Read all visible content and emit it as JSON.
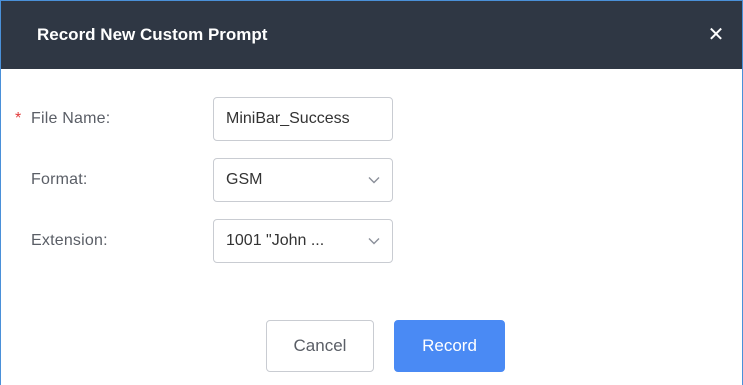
{
  "dialog": {
    "title": "Record New Custom Prompt",
    "close_glyph": "✕"
  },
  "form": {
    "file_name": {
      "required_mark": "*",
      "label": "File Name:",
      "value": "MiniBar_Success"
    },
    "format": {
      "label": "Format:",
      "selected": "GSM"
    },
    "extension": {
      "label": "Extension:",
      "selected": "1001 \"John ..."
    }
  },
  "buttons": {
    "cancel_label": "Cancel",
    "record_label": "Record"
  },
  "colors": {
    "header_bg": "#2f3744",
    "primary": "#4a8af4",
    "required": "#e23b3b"
  },
  "icons": {
    "close": "close-icon",
    "dropdown": "chevron-down-icon"
  }
}
